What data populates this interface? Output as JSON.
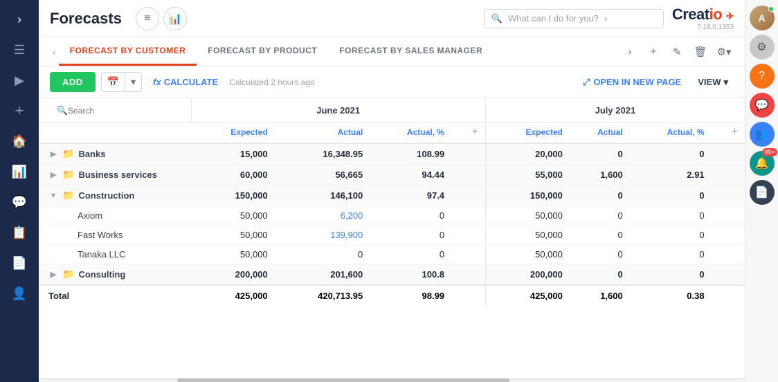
{
  "app": {
    "title": "Forecasts",
    "logo": "Creatio",
    "logo_version": "7.18.0.1353",
    "search_placeholder": "What can I do for you?"
  },
  "tabs": {
    "prev_arrow": "‹",
    "items": [
      {
        "id": "by-customer",
        "label": "FORECAST BY CUSTOMER",
        "active": true
      },
      {
        "id": "by-product",
        "label": "FORECAST BY PRODUCT",
        "active": false
      },
      {
        "id": "by-sales-manager",
        "label": "FORECAST BY SALES MANAGER",
        "active": false
      }
    ],
    "actions": {
      "nav_right": "›",
      "add": "+",
      "edit": "✎",
      "delete": "🗑",
      "settings": "⚙"
    }
  },
  "toolbar": {
    "add_label": "ADD",
    "calendar_icon": "📅",
    "fx_icon": "fx",
    "calculate_label": "CALCULATE",
    "calc_note": "Calculated 2 hours ago",
    "open_new_label": "OPEN IN NEW PAGE",
    "view_label": "VIEW"
  },
  "table": {
    "search_placeholder": "Search",
    "months": [
      {
        "label": "June 2021",
        "colspan": 4
      },
      {
        "label": "July 2021",
        "colspan": 4
      }
    ],
    "columns": [
      {
        "id": "name",
        "label": ""
      },
      {
        "id": "jun_expected",
        "label": "Expected"
      },
      {
        "id": "jun_actual",
        "label": "Actual"
      },
      {
        "id": "jun_actual_pct",
        "label": "Actual, %"
      },
      {
        "id": "jun_add",
        "label": "+"
      },
      {
        "id": "jul_expected",
        "label": "Expected"
      },
      {
        "id": "jul_actual",
        "label": "Actual"
      },
      {
        "id": "jul_actual_pct",
        "label": "Actual, %"
      },
      {
        "id": "jul_add",
        "label": "+"
      }
    ],
    "rows": [
      {
        "type": "group",
        "id": "banks",
        "name": "Banks",
        "expanded": false,
        "jun_expected": "15,000",
        "jun_actual": "16,348.95",
        "jun_actual_pct": "108.99",
        "jul_expected": "20,000",
        "jul_actual": "0",
        "jul_actual_pct": "0"
      },
      {
        "type": "group",
        "id": "business-services",
        "name": "Business services",
        "expanded": false,
        "jun_expected": "60,000",
        "jun_actual": "56,665",
        "jun_actual_pct": "94.44",
        "jul_expected": "55,000",
        "jul_actual": "1,600",
        "jul_actual_pct": "2.91"
      },
      {
        "type": "group",
        "id": "construction",
        "name": "Construction",
        "expanded": true,
        "jun_expected": "150,000",
        "jun_actual": "146,100",
        "jun_actual_pct": "97.4",
        "jul_expected": "150,000",
        "jul_actual": "0",
        "jul_actual_pct": "0",
        "children": [
          {
            "name": "Axiom",
            "jun_expected": "50,000",
            "jun_actual": "6,200",
            "jun_actual_pct": "0",
            "jul_expected": "50,000",
            "jul_actual": "0",
            "jul_actual_pct": "0",
            "actual_blue": true
          },
          {
            "name": "Fast Works",
            "jun_expected": "50,000",
            "jun_actual": "139,900",
            "jun_actual_pct": "0",
            "jul_expected": "50,000",
            "jul_actual": "0",
            "jul_actual_pct": "0",
            "actual_blue": true
          },
          {
            "name": "Tanaka LLC",
            "jun_expected": "50,000",
            "jun_actual": "0",
            "jun_actual_pct": "0",
            "jul_expected": "50,000",
            "jul_actual": "0",
            "jul_actual_pct": "0"
          }
        ]
      },
      {
        "type": "group",
        "id": "consulting",
        "name": "Consulting",
        "expanded": false,
        "jun_expected": "200,000",
        "jun_actual": "201,600",
        "jun_actual_pct": "100.8",
        "jul_expected": "200,000",
        "jul_actual": "0",
        "jul_actual_pct": "0"
      }
    ],
    "footer": {
      "label": "Total",
      "jun_expected": "425,000",
      "jun_actual": "420,713.95",
      "jun_actual_pct": "98.99",
      "jul_expected": "425,000",
      "jul_actual": "1,600",
      "jul_actual_pct": "0.38"
    }
  },
  "left_nav": {
    "icons": [
      "›",
      "☰",
      "▶",
      "+",
      "🏠",
      "📊",
      "💬",
      "📋",
      "📄",
      "👤"
    ]
  },
  "right_sidebar": {
    "user_initial": "A",
    "items": [
      "gear",
      "question",
      "chat-active",
      "chat2",
      "bell",
      "document"
    ]
  }
}
